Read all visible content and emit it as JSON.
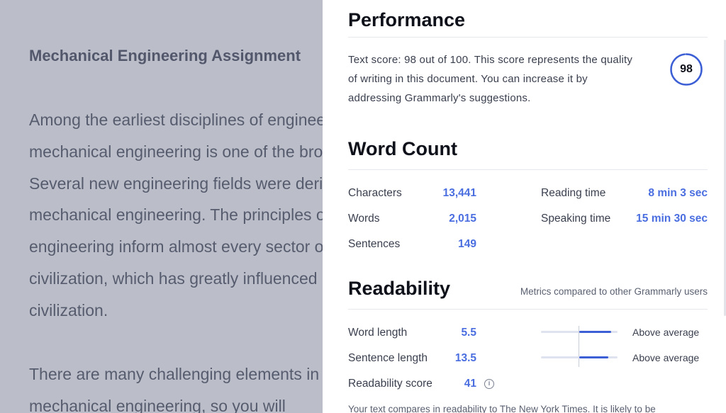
{
  "document": {
    "title": "Mechanical Engineering Assignment",
    "paragraph1": [
      "Among the earliest disciplines of engineering,",
      "mechanical engineering is one of the broadest.",
      "Several new engineering fields were derived from",
      "mechanical engineering. The principles of mechanical",
      "engineering inform almost every sector of modern",
      "civilization, which has greatly influenced human",
      "civilization."
    ],
    "paragraph2": [
      "There are many challenging elements in",
      "mechanical engineering, so you will"
    ]
  },
  "performance": {
    "heading": "Performance",
    "text": "Text score: 98 out of 100. This score represents the quality of writing in this document. You can increase it by addressing Grammarly's suggestions.",
    "score": "98",
    "score_fraction": 0.98
  },
  "word_count": {
    "heading": "Word Count",
    "left": [
      {
        "label": "Characters",
        "value": "13,441"
      },
      {
        "label": "Words",
        "value": "2,015"
      },
      {
        "label": "Sentences",
        "value": "149"
      }
    ],
    "right": [
      {
        "label": "Reading time",
        "value": "8 min 3 sec"
      },
      {
        "label": "Speaking time",
        "value": "15 min 30 sec"
      }
    ]
  },
  "readability": {
    "heading": "Readability",
    "note": "Metrics compared to other Grammarly users",
    "rows": [
      {
        "label": "Word length",
        "value": "5.5",
        "rating": "Above average",
        "fill_start": 0.5,
        "fill_end": 0.92
      },
      {
        "label": "Sentence length",
        "value": "13.5",
        "rating": "Above average",
        "fill_start": 0.5,
        "fill_end": 0.88
      }
    ],
    "score_label": "Readability score",
    "score_value": "41",
    "comparison": "Your text compares in readability to The New York Times. It is likely to be"
  },
  "colors": {
    "accent": "#4a6ee0",
    "ring": "#3c5fd6",
    "overlay": "#787e94"
  }
}
